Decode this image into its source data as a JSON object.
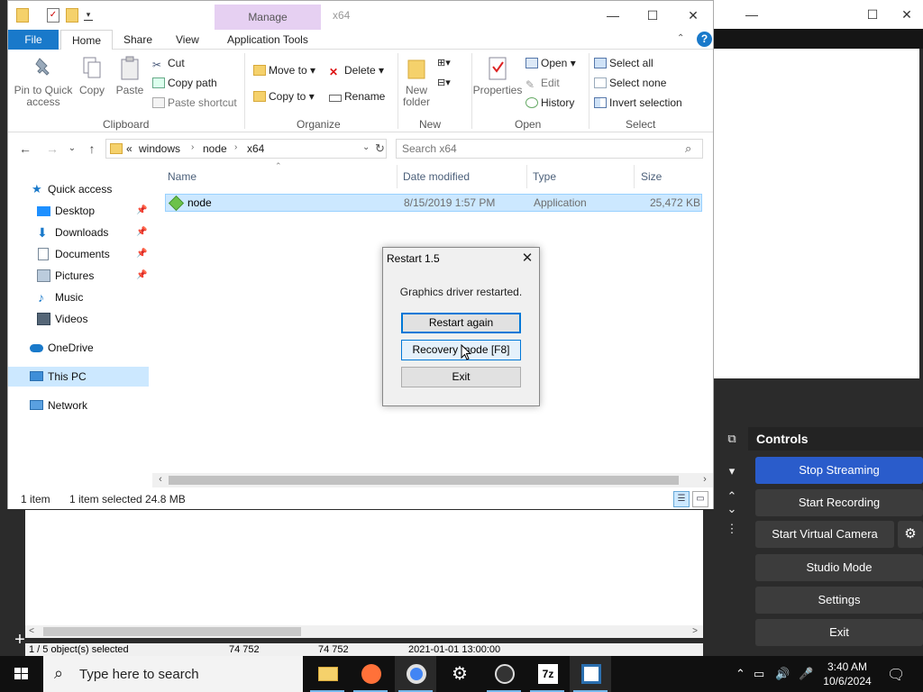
{
  "explorer": {
    "title": "x64",
    "contextual_tab": "Manage",
    "tabs": {
      "file": "File",
      "home": "Home",
      "share": "Share",
      "view": "View",
      "app_tools": "Application Tools"
    },
    "ribbon": {
      "clipboard": {
        "label": "Clipboard",
        "pin": "Pin to Quick access",
        "copy": "Copy",
        "paste": "Paste",
        "cut": "Cut",
        "copy_path": "Copy path",
        "paste_shortcut": "Paste shortcut"
      },
      "organize": {
        "label": "Organize",
        "move_to": "Move to",
        "copy_to": "Copy to",
        "delete": "Delete",
        "rename": "Rename"
      },
      "new": {
        "label": "New",
        "new_folder": "New folder"
      },
      "open": {
        "label": "Open",
        "properties": "Properties",
        "open": "Open",
        "edit": "Edit",
        "history": "History"
      },
      "select": {
        "label": "Select",
        "select_all": "Select all",
        "select_none": "Select none",
        "invert": "Invert selection"
      }
    },
    "address": {
      "overflow": "«",
      "crumbs": [
        "windows",
        "node",
        "x64"
      ]
    },
    "search_placeholder": "Search x64",
    "nav": {
      "quick_access": "Quick access",
      "desktop": "Desktop",
      "downloads": "Downloads",
      "documents": "Documents",
      "pictures": "Pictures",
      "music": "Music",
      "videos": "Videos",
      "onedrive": "OneDrive",
      "this_pc": "This PC",
      "network": "Network"
    },
    "columns": {
      "name": "Name",
      "date": "Date modified",
      "type": "Type",
      "size": "Size"
    },
    "files": [
      {
        "name": "node",
        "date": "8/15/2019 1:57 PM",
        "type": "Application",
        "size": "25,472 KB"
      }
    ],
    "status": {
      "count": "1 item",
      "selected": "1 item selected  24.8 MB"
    }
  },
  "dialog": {
    "title": "Restart 1.5",
    "message": "Graphics driver restarted.",
    "restart_again": "Restart again",
    "recovery_mode": "Recovery mode [F8]",
    "exit": "Exit"
  },
  "obs": {
    "controls_title": "Controls",
    "stop_streaming": "Stop Streaming",
    "start_recording": "Start Recording",
    "start_virtual_camera": "Start Virtual Camera",
    "studio_mode": "Studio Mode",
    "settings": "Settings",
    "exit": "Exit",
    "status": {
      "selected": "1 / 5 object(s) selected",
      "v1": "74 752",
      "v2": "74 752",
      "date": "2021-01-01 13:00:00"
    }
  },
  "taskbar": {
    "search_placeholder": "Type here to search",
    "time": "3:40 AM",
    "date": "10/6/2024"
  },
  "colors": {
    "accent": "#1979ca",
    "selection": "#cce8ff",
    "manage_tab": "#e6d0f2",
    "obs_active": "#2a5ccb"
  }
}
